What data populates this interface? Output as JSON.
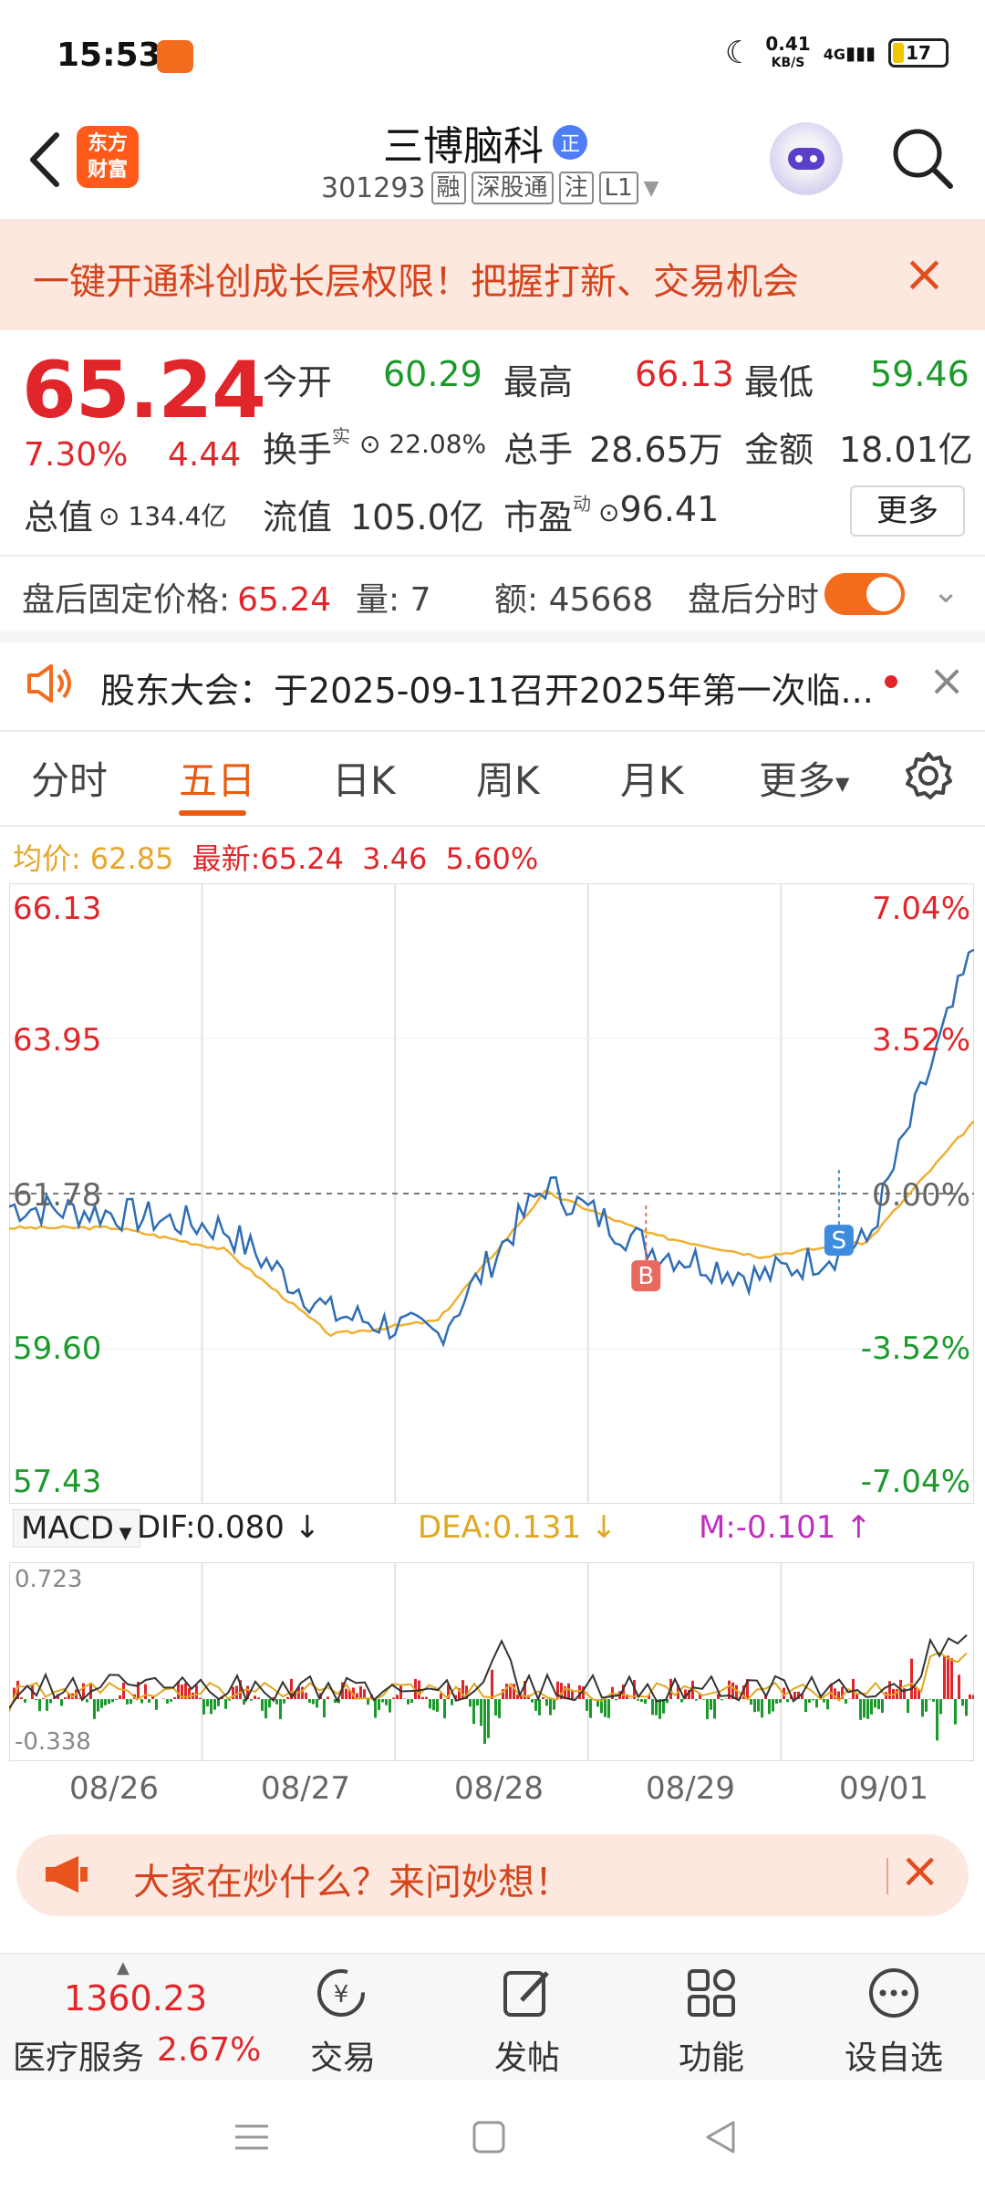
{
  "status": {
    "time": "15:53",
    "speed": "0.41",
    "speed_unit": "KB/S",
    "net": "4G",
    "battery": "17"
  },
  "header": {
    "logo": "东方\n财富",
    "title": "三博脑科",
    "title_badge": "正",
    "code": "301293",
    "tags": [
      "融",
      "深股通",
      "注",
      "L1"
    ]
  },
  "banner": {
    "text": "一键开通科创成长层权限！把握打新、交易机会"
  },
  "quote": {
    "price": "65.24",
    "change_pct": "7.30%",
    "change": "4.44",
    "open_label": "今开",
    "open": "60.29",
    "high_label": "最高",
    "high": "66.13",
    "low_label": "最低",
    "low": "59.46",
    "turnover_label": "换手",
    "turnover_sup": "实",
    "turnover": "22.08%",
    "volume_label": "总手",
    "volume": "28.65万",
    "amount_label": "金额",
    "amount": "18.01亿",
    "mktcap_label": "总值",
    "mktcap": "134.4亿",
    "float_label": "流值",
    "float": "105.0亿",
    "pe_label": "市盈",
    "pe_sup": "动",
    "pe": "96.41",
    "more": "更多"
  },
  "afterhours": {
    "price_label": "盘后固定价格:",
    "price": "65.24",
    "vol_label": "量:",
    "vol": "7",
    "amt_label": "额:",
    "amt": "45668",
    "timeshare_label": "盘后分时"
  },
  "notice": {
    "text": "股东大会：于2025-09-11召开2025年第一次临..."
  },
  "tabs": [
    "分时",
    "五日",
    "日K",
    "周K",
    "月K",
    "更多"
  ],
  "avg_line": {
    "avg_label": "均价:",
    "avg": "62.85",
    "latest_label": "最新:",
    "latest": "65.24",
    "chg": "3.46",
    "pct": "5.60%"
  },
  "chart_data": {
    "type": "line",
    "title": "",
    "y_labels_left": [
      "66.13",
      "63.95",
      "61.78",
      "59.60",
      "57.43"
    ],
    "y_labels_right": [
      "7.04%",
      "3.52%",
      "0.00%",
      "-3.52%",
      "-7.04%"
    ],
    "ylim": [
      57.43,
      66.13
    ],
    "reference": 61.78,
    "categories": [
      "08/26",
      "08/27",
      "08/28",
      "08/29",
      "09/01"
    ],
    "series": [
      {
        "name": "",
        "values": [
          61.6,
          61.5,
          61.3,
          60.1,
          59.8,
          61.9,
          61.0,
          60.6,
          61.1,
          65.2
        ]
      },
      {
        "name": "均价",
        "values": [
          61.3,
          61.3,
          61.0,
          59.8,
          60.0,
          61.8,
          61.2,
          60.9,
          61.1,
          62.8
        ]
      }
    ],
    "markers": [
      {
        "label": "B",
        "day": "08/29"
      },
      {
        "label": "S",
        "day": "09/01"
      }
    ],
    "macd": {
      "dif_label": "DIF:0.080",
      "dea_label": "DEA:0.131",
      "m_label": "M:-0.101",
      "top": "0.723",
      "bottom": "-0.338",
      "selector": "MACD"
    }
  },
  "ai_bar": {
    "text": "大家在炒什么？来问妙想！"
  },
  "bottom_nav": {
    "index": "1360.23",
    "sector": "医疗服务",
    "sector_pct": "2.67%",
    "items": [
      "交易",
      "发帖",
      "功能",
      "设自选"
    ]
  },
  "colors": {
    "up": "#e0262a",
    "down": "#1b9a2b",
    "accent": "#f36b1c",
    "line": "#2f6db5",
    "avg": "#f0b030"
  }
}
